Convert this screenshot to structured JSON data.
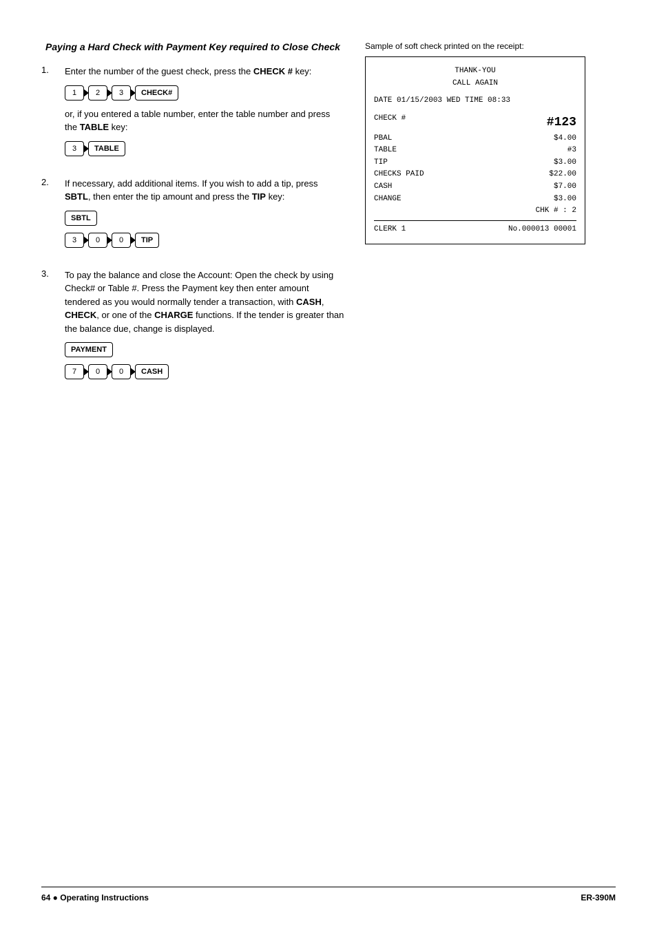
{
  "page": {
    "section_title": "Paying a Hard Check with Payment Key required to Close Check",
    "footer_left": "64   ●   Operating Instructions",
    "footer_right": "ER-390M"
  },
  "steps": [
    {
      "number": "1.",
      "paragraph1": "Enter the number of the guest check, press the ",
      "bold1": "CHECK #",
      "p1_end": " key:",
      "keys1": [
        "1",
        "2",
        "3",
        "CHECK#"
      ],
      "paragraph2": "or, if you entered a table number, enter the table number and press the ",
      "bold2": "TABLE",
      "p2_end": " key:",
      "keys2": [
        "3",
        "TABLE"
      ]
    },
    {
      "number": "2.",
      "paragraph1": "If necessary, add additional items.  If you wish to add a tip, press ",
      "bold1": "SBTL",
      "p1_mid": ", then enter the tip amount and press the ",
      "bold2": "TIP",
      "p1_end": " key:",
      "keys1": [
        "SBTL"
      ],
      "keys2": [
        "3",
        "0",
        "0",
        "TIP"
      ]
    },
    {
      "number": "3.",
      "paragraph1": "To pay the balance and close the Account:   Open the check by using Check# or Table #.   Press the Payment key then enter amount tendered as you would normally tender a transaction, with ",
      "bold1": "CASH",
      "p1_mid1": ", ",
      "bold2": "CHECK",
      "p1_mid2": ", or one of the ",
      "bold3": "CHARGE",
      "p1_end": " functions.   If the tender is greater than the balance due, change is displayed.",
      "keys1": [
        "PAYMENT"
      ],
      "keys2": [
        "7",
        "0",
        "0",
        "CASH"
      ]
    }
  ],
  "receipt": {
    "sample_text": "Sample of soft check printed on the receipt:",
    "line1": "THANK-YOU",
    "line2": "CALL AGAIN",
    "date_line": "DATE 01/15/2003 WED   TIME 08:33",
    "check_label": "CHECK #",
    "check_value": "#123",
    "pbal_label": "PBAL",
    "pbal_value": "$4.00",
    "table_label": "TABLE",
    "table_value": "#3",
    "tip_label": "TIP",
    "tip_value": "$3.00",
    "checks_paid_label": "CHECKS PAID",
    "checks_paid_value": "$22.00",
    "cash_label": "CASH",
    "cash_value": "$7.00",
    "change_label": "CHANGE",
    "change_value": "$3.00",
    "chk_label": "CHK # : 2",
    "clerk_label": "CLERK 1",
    "clerk_value": "No.000013   00001"
  },
  "icons": {
    "bullet": "●"
  }
}
